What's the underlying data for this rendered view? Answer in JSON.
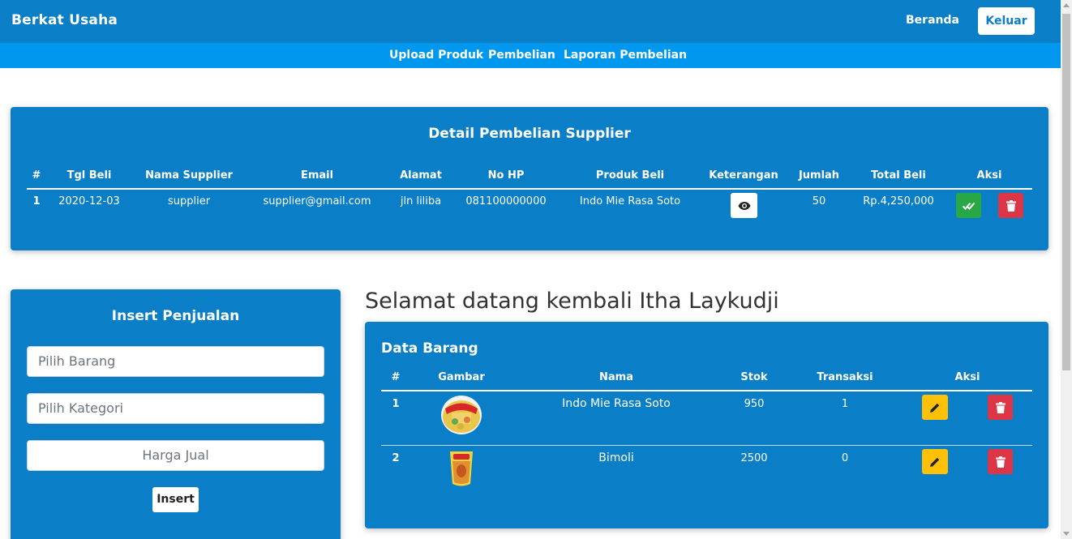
{
  "header": {
    "brand": "Berkat Usaha",
    "home_label": "Beranda",
    "logout_label": "Keluar"
  },
  "subnav": {
    "items": [
      "Upload Produk",
      "Pembelian",
      "Laporan Pembelian"
    ]
  },
  "purchase_detail": {
    "title": "Detail Pembelian Supplier",
    "columns": [
      "#",
      "Tgl Beli",
      "Nama Supplier",
      "Email",
      "Alamat",
      "No HP",
      "Produk Beli",
      "Keterangan",
      "Jumlah",
      "Total Beli",
      "Aksi"
    ],
    "rows": [
      {
        "no": "1",
        "date": "2020-12-03",
        "supplier": "supplier",
        "email": "supplier@gmail.com",
        "address": "jln liliba",
        "phone": "081100000000",
        "product": "Indo Mie Rasa Soto",
        "qty": "50",
        "total": "Rp.4,250,000"
      }
    ]
  },
  "sales_form": {
    "title": "Insert Penjualan",
    "item_placeholder": "Pilih Barang",
    "category_placeholder": "Pilih Kategori",
    "price_placeholder": "Harga Jual",
    "submit_label": "Insert"
  },
  "welcome": "Selamat datang kembali Itha Laykudji",
  "items_table": {
    "title": "Data Barang",
    "columns": [
      "#",
      "Gambar",
      "Nama",
      "Stok",
      "Transaksi",
      "Aksi"
    ],
    "rows": [
      {
        "no": "1",
        "image": "indomie-soto-product-image",
        "name": "Indo Mie Rasa Soto",
        "stock": "950",
        "transactions": "1"
      },
      {
        "no": "2",
        "image": "bimoli-oil-product-image",
        "name": "Bimoli",
        "stock": "2500",
        "transactions": "0"
      }
    ]
  },
  "icons": {
    "view": "eye-icon",
    "approve": "double-check-icon",
    "delete": "trash-icon",
    "edit": "pencil-icon"
  },
  "colors": {
    "primary": "#0a7ec6",
    "subnav": "#0098ef",
    "success": "#28a745",
    "danger": "#dc3545",
    "warning": "#ffc107"
  }
}
